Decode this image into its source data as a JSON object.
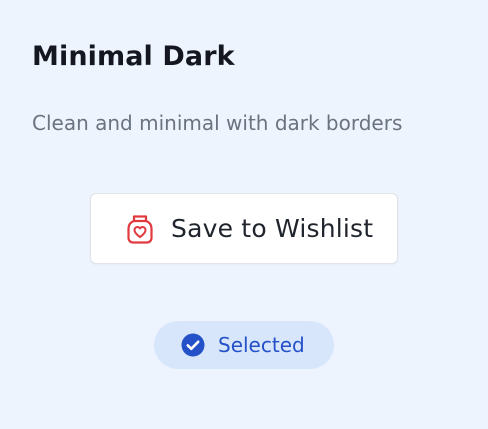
{
  "card": {
    "title": "Minimal Dark",
    "description": "Clean and minimal with dark borders"
  },
  "wishlist_button": {
    "label": "Save to Wishlist",
    "icon": "heart-bag-icon",
    "icon_color": "#e0393e"
  },
  "status_badge": {
    "label": "Selected",
    "icon": "check-circle-icon",
    "color": "#2450c8",
    "background": "#d7e6fb"
  },
  "colors": {
    "page_background": "#eef4fd",
    "title": "#14171f",
    "description": "#6a7380"
  }
}
